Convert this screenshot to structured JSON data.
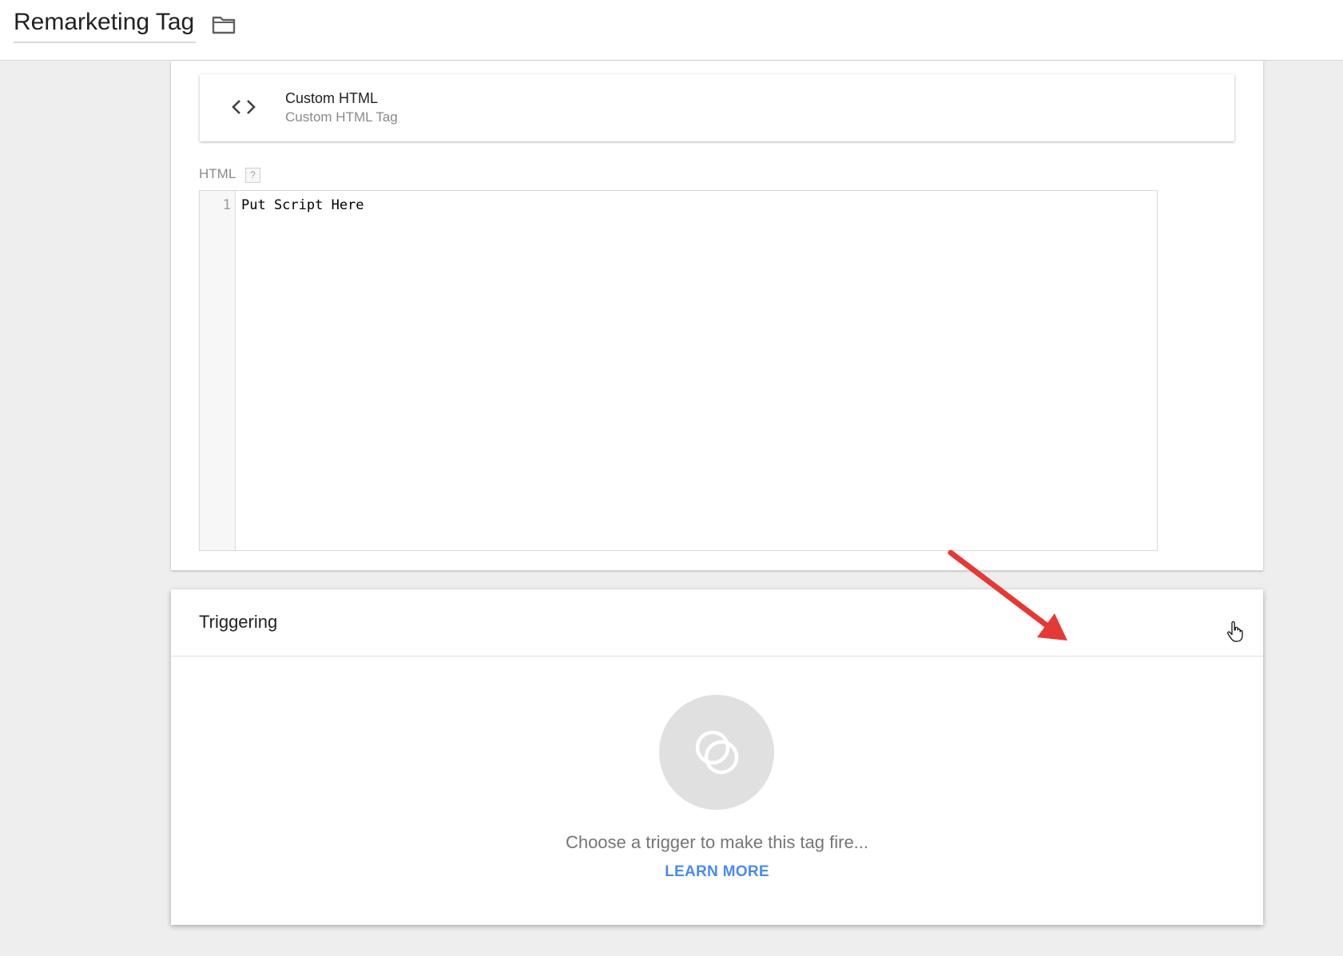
{
  "header": {
    "tag_name": "Remarketing Tag",
    "folder_icon": "folder-icon"
  },
  "tag_configuration": {
    "tag_type": {
      "icon": "code-brackets-icon",
      "name": "Custom HTML",
      "subtitle": "Custom HTML Tag"
    },
    "html_field": {
      "label": "HTML",
      "help": "?",
      "lines": [
        {
          "number": "1",
          "text": "Put Script Here"
        }
      ]
    }
  },
  "triggering": {
    "title": "Triggering",
    "empty_icon": "overlapping-circles-icon",
    "empty_message": "Choose a trigger to make this tag fire...",
    "learn_more": "LEARN MORE"
  },
  "annotation": {
    "arrow_color": "#e53935",
    "cursor": "hand-pointer-icon"
  },
  "colors": {
    "link": "#4a8af4",
    "background": "#eeeeee"
  }
}
